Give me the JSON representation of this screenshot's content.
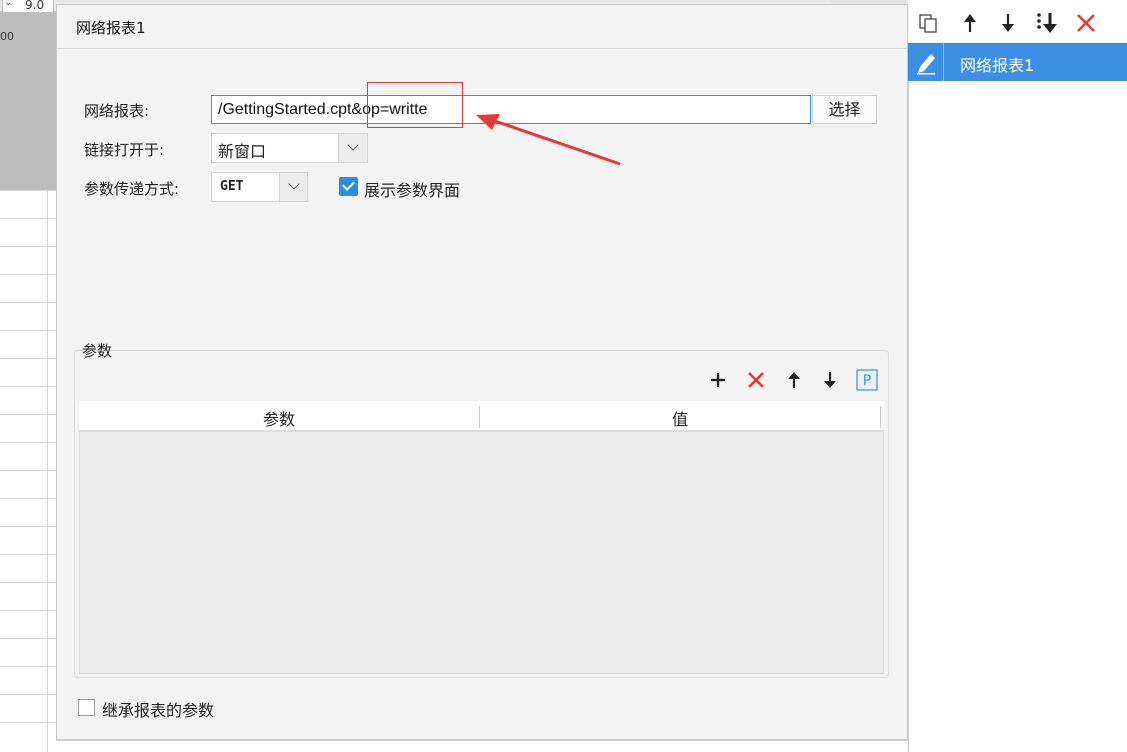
{
  "background": {
    "font_size_value": "9.0",
    "ruler_number": "00"
  },
  "dialog": {
    "title": "网络报表1",
    "fields": {
      "report_label": "网络报表:",
      "report_value": "/GettingStarted.cpt&op=writte",
      "select_button": "选择",
      "open_in_label": "链接打开于:",
      "open_in_value": "新窗口",
      "param_mode_label": "参数传递方式:",
      "param_mode_value": "GET",
      "show_param_label": "展示参数界面",
      "show_param_checked": true
    },
    "params": {
      "group_title": "参数",
      "columns": [
        "参数",
        "值"
      ],
      "rows": []
    },
    "inherit_label": "继承报表的参数",
    "inherit_checked": false
  },
  "right_panel": {
    "items": [
      {
        "label": "网络报表1",
        "selected": true
      }
    ]
  },
  "icons": {
    "toolbar": [
      "copy-icon",
      "arrow-up-icon",
      "arrow-down-icon",
      "move-bottom-icon",
      "delete-icon"
    ],
    "params_toolbar": [
      "add-icon",
      "delete-icon",
      "arrow-up-icon",
      "arrow-down-icon",
      "param-p-icon"
    ]
  },
  "colors": {
    "accent": "#3d8fe4",
    "delete": "#e53935",
    "annotation": "#e53935"
  }
}
